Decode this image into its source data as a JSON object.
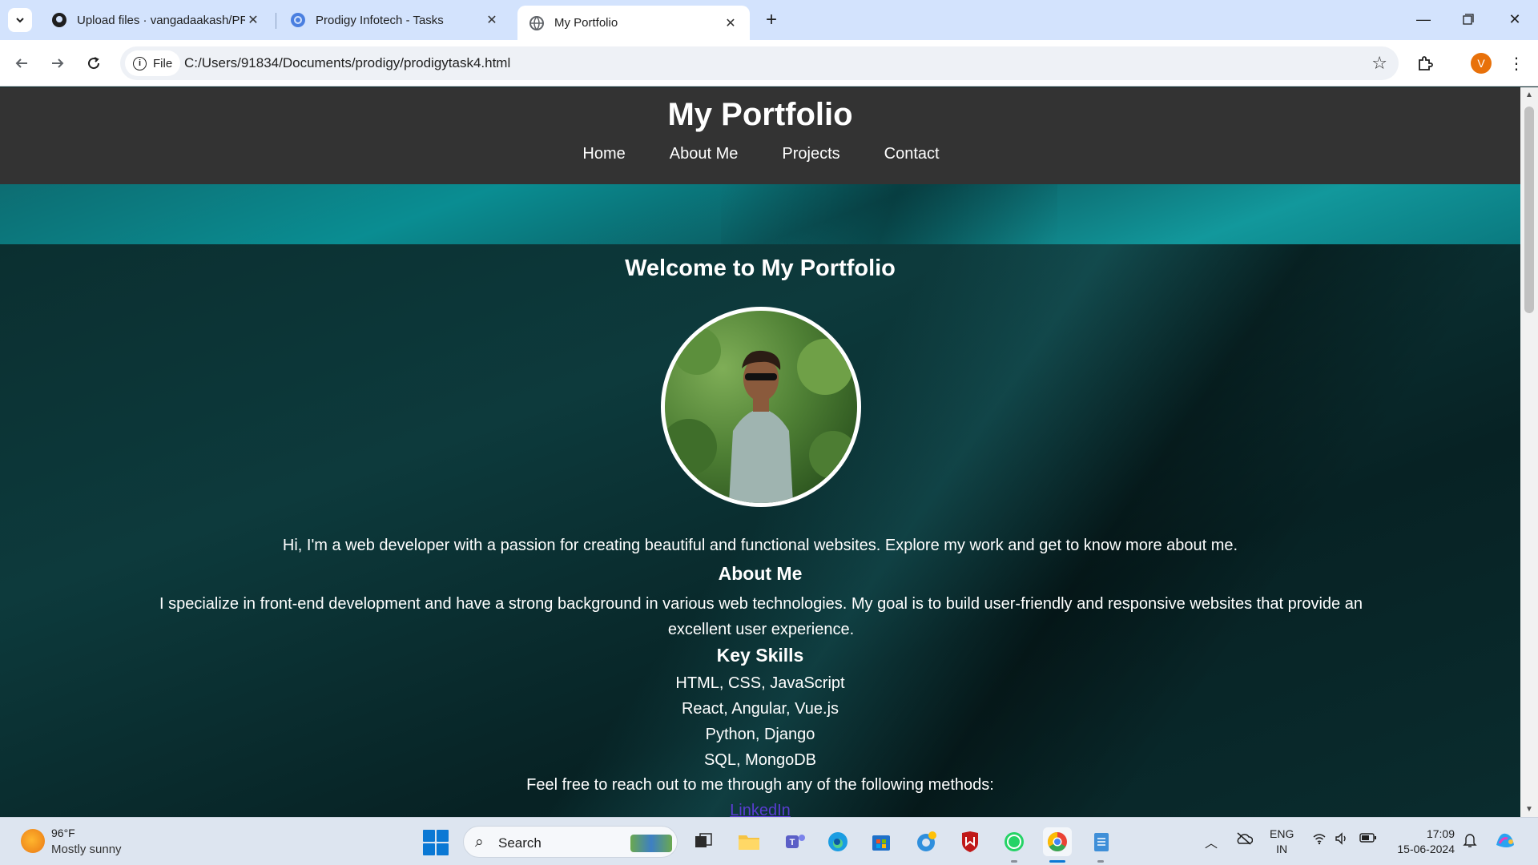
{
  "browser": {
    "tabs": [
      {
        "title": "Upload files · vangadaakash/PR",
        "favicon": "github-icon"
      },
      {
        "title": "Prodigy Infotech - Tasks",
        "favicon": "globe-blue-icon"
      },
      {
        "title": "My Portfolio",
        "favicon": "globe-icon"
      }
    ],
    "site_chip": "File",
    "url": "C:/Users/91834/Documents/prodigy/prodigytask4.html",
    "profile_initial": "V"
  },
  "page": {
    "site_title": "My Portfolio",
    "nav": [
      "Home",
      "About Me",
      "Projects",
      "Contact"
    ],
    "welcome": "Welcome to My Portfolio",
    "intro": "Hi, I'm a web developer with a passion for creating beautiful and functional websites. Explore my work and get to know more about me.",
    "about_heading": "About Me",
    "about_text": "I specialize in front-end development and have a strong background in various web technologies. My goal is to build user-friendly and responsive websites that provide an excellent user experience.",
    "skills_heading": "Key Skills",
    "skills": [
      "HTML, CSS, JavaScript",
      "React, Angular, Vue.js",
      "Python, Django",
      "SQL, MongoDB"
    ],
    "reach": "Feel free to reach out to me through any of the following methods:",
    "linkedin": "LinkedIn"
  },
  "taskbar": {
    "weather_temp": "96°F",
    "weather_desc": "Mostly sunny",
    "search_label": "Search",
    "lang_line1": "ENG",
    "lang_line2": "IN",
    "time": "17:09",
    "date": "15-06-2024"
  },
  "colors": {
    "header_bg": "#333333",
    "tabbar_bg": "#d3e3fd",
    "link": "#5a3dd1",
    "page_bg": "#0b2b2d"
  }
}
